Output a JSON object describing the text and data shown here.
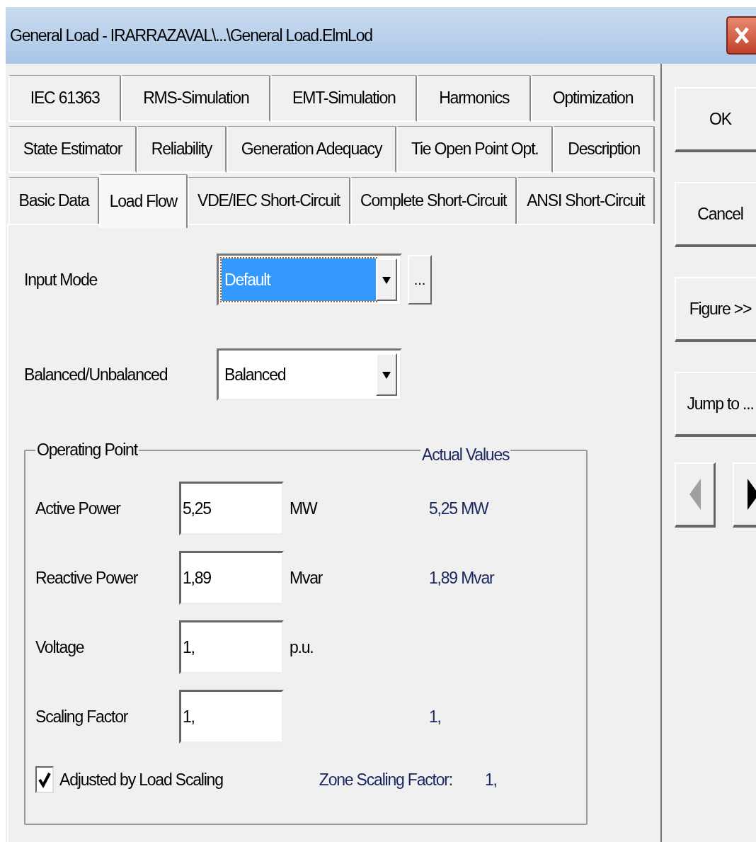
{
  "window": {
    "title": "General Load - IRARRAZAVAL\\...\\General Load.ElmLod"
  },
  "tab_rows": [
    [
      {
        "label": "IEC 61363",
        "selected": false
      },
      {
        "label": "RMS-Simulation",
        "selected": false
      },
      {
        "label": "EMT-Simulation",
        "selected": false
      },
      {
        "label": "Harmonics",
        "selected": false
      },
      {
        "label": "Optimization",
        "selected": false
      }
    ],
    [
      {
        "label": "State Estimator",
        "selected": false
      },
      {
        "label": "Reliability",
        "selected": false
      },
      {
        "label": "Generation Adequacy",
        "selected": false
      },
      {
        "label": "Tie Open Point Opt.",
        "selected": false
      },
      {
        "label": "Description",
        "selected": false
      }
    ],
    [
      {
        "label": "Basic Data",
        "selected": false
      },
      {
        "label": "Load Flow",
        "selected": true
      },
      {
        "label": "VDE/IEC Short-Circuit",
        "selected": false
      },
      {
        "label": "Complete Short-Circuit",
        "selected": false
      },
      {
        "label": "ANSI Short-Circuit",
        "selected": false
      }
    ]
  ],
  "buttons": [
    {
      "label": "OK"
    },
    {
      "label": "Cancel"
    },
    {
      "label": "Figure >>"
    },
    {
      "label": "Jump to ..."
    }
  ],
  "nav_buttons": [
    {
      "kind": "left",
      "disabled": true
    },
    {
      "kind": "right",
      "disabled": false
    }
  ],
  "input_mode": {
    "label": "Input Mode",
    "value": "Default",
    "focused": true,
    "more_button": "..."
  },
  "balance": {
    "label": "Balanced/Unbalanced",
    "value": "Balanced",
    "focused": false
  },
  "operating_point": {
    "title": "Operating Point",
    "actual_title": "Actual Values",
    "rows": [
      {
        "label": "Active Power",
        "value": "5,25",
        "unit": "MW",
        "actual": "5,25 MW"
      },
      {
        "label": "Reactive Power",
        "value": "1,89",
        "unit": "Mvar",
        "actual": "1,89 Mvar"
      },
      {
        "label": "Voltage",
        "value": "1,",
        "unit": "p.u."
      },
      {
        "label": "Scaling Factor",
        "value": "1,",
        "actual": "1,"
      }
    ],
    "checkbox": {
      "label": "Adjusted by Load Scaling",
      "checked": true
    },
    "zone": {
      "label": "Zone Scaling Factor:",
      "value": "1,"
    }
  }
}
